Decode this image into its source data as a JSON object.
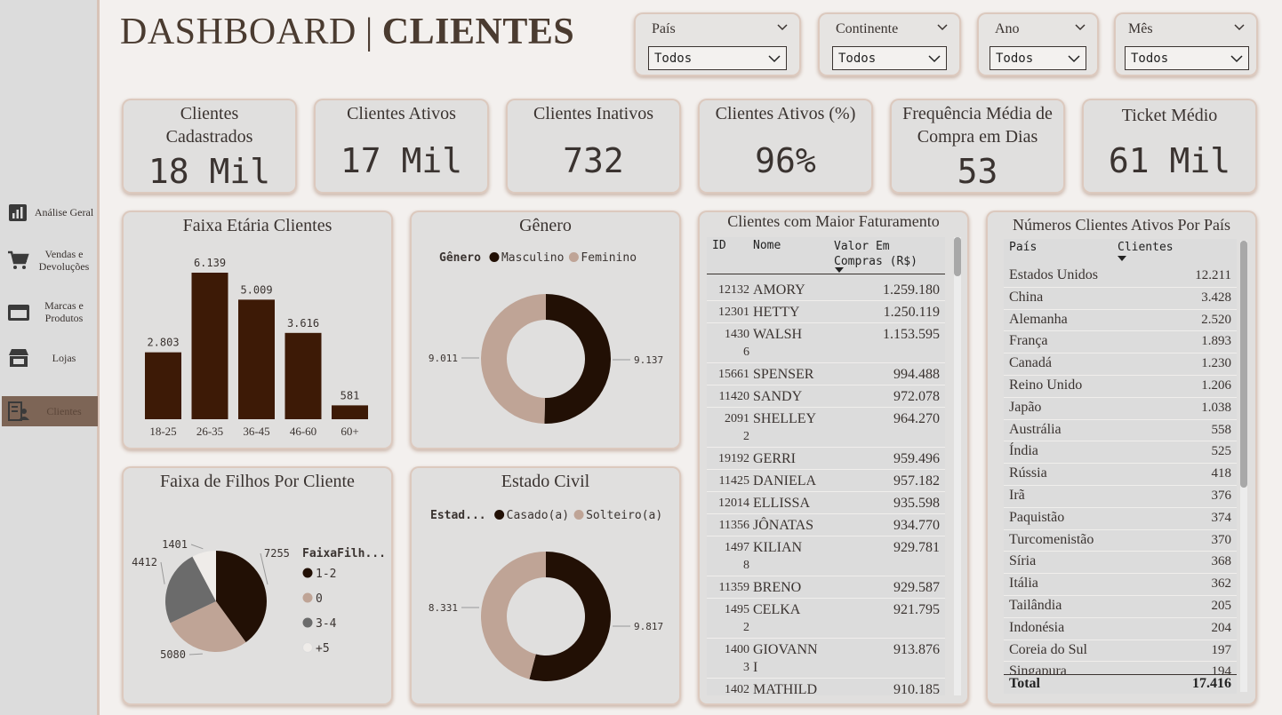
{
  "sidebar": {
    "items": [
      {
        "label": "Análise Geral",
        "icon": "bar-chart-icon"
      },
      {
        "label": "Vendas e Devoluções",
        "icon": "cart-icon"
      },
      {
        "label": "Marcas e Produtos",
        "icon": "wallet-icon"
      },
      {
        "label": "Lojas",
        "icon": "store-icon"
      },
      {
        "label": "Clientes",
        "icon": "customers-icon",
        "active": true
      }
    ]
  },
  "header": {
    "title_a": "DASHBOARD",
    "title_sep": "|",
    "title_b": "CLIENTES"
  },
  "filters": [
    {
      "label": "País",
      "value": "Todos"
    },
    {
      "label": "Continente",
      "value": "Todos"
    },
    {
      "label": "Ano",
      "value": "Todos"
    },
    {
      "label": "Mês",
      "value": "Todos"
    }
  ],
  "kpis": [
    {
      "title": "Clientes Cadastrados",
      "value": "18 Mil"
    },
    {
      "title": "Clientes Ativos",
      "value": "17 Mil"
    },
    {
      "title": "Clientes Inativos",
      "value": "732"
    },
    {
      "title": "Clientes Ativos (%)",
      "value": "96%"
    },
    {
      "title": "Frequência Média de Compra em Dias",
      "value": "53"
    },
    {
      "title": "Ticket Médio",
      "value": "61 Mil"
    }
  ],
  "colors": {
    "dark_brown": "#3d1a06",
    "very_dark": "#221005",
    "tan": "#bfa496",
    "gray": "#6b6b6b",
    "light": "#efece9"
  },
  "chart_data": [
    {
      "type": "bar",
      "title": "Faixa Etária Clientes",
      "categories": [
        "18-25",
        "26-35",
        "36-45",
        "46-60",
        "60+"
      ],
      "values": [
        2803,
        6139,
        5009,
        3616,
        581
      ],
      "value_labels": [
        "2.803",
        "6.139",
        "5.009",
        "3.616",
        "581"
      ]
    },
    {
      "type": "pie",
      "subtype": "donut",
      "title": "Gênero",
      "legend_title": "Gênero",
      "labels": [
        "Masculino",
        "Feminino"
      ],
      "values": [
        9137,
        9011
      ],
      "value_labels": [
        "9.137",
        "9.011"
      ]
    },
    {
      "type": "pie",
      "title": "Faixa de Filhos Por Cliente",
      "legend_title": "FaixaFilh...",
      "labels": [
        "1-2",
        "0",
        "3-4",
        "+5"
      ],
      "values": [
        7255,
        5080,
        4412,
        1401
      ],
      "value_labels": [
        "7255",
        "5080",
        "4412",
        "1401"
      ]
    },
    {
      "type": "pie",
      "subtype": "donut",
      "title": "Estado Civil",
      "legend_title": "Estad...",
      "labels": [
        "Casado(a)",
        "Solteiro(a)"
      ],
      "values": [
        9817,
        8331
      ],
      "value_labels": [
        "9.817",
        "8.331"
      ]
    },
    {
      "type": "table",
      "title": "Clientes com Maior Faturamento",
      "columns": [
        "ID",
        "Nome",
        "Valor Em Compras (R$)"
      ],
      "rows": [
        [
          "12132",
          "AMORY",
          "1.259.180"
        ],
        [
          "12301",
          "HETTY",
          "1.250.119"
        ],
        [
          "14306",
          "WALSH",
          "1.153.595"
        ],
        [
          "15661",
          "SPENSER",
          "994.488"
        ],
        [
          "11420",
          "SANDY",
          "972.078"
        ],
        [
          "20912",
          "SHELLEY",
          "964.270"
        ],
        [
          "19192",
          "GERRI",
          "959.496"
        ],
        [
          "11425",
          "DANIELA",
          "957.182"
        ],
        [
          "12014",
          "ELLISSA",
          "935.598"
        ],
        [
          "11356",
          "JÔNATAS",
          "934.770"
        ],
        [
          "14978",
          "KILIAN",
          "929.781"
        ],
        [
          "11359",
          "BRENO",
          "929.587"
        ],
        [
          "14952",
          "CELKA",
          "921.795"
        ],
        [
          "14003",
          "GIOVANNI",
          "913.876"
        ],
        [
          "1402",
          "MATHILD",
          "910.185"
        ]
      ]
    },
    {
      "type": "table",
      "title": "Números Clientes Ativos Por País",
      "columns": [
        "País",
        "Clientes"
      ],
      "rows": [
        [
          "Estados Unidos",
          "12.211"
        ],
        [
          "China",
          "3.428"
        ],
        [
          "Alemanha",
          "2.520"
        ],
        [
          "França",
          "1.893"
        ],
        [
          "Canadá",
          "1.230"
        ],
        [
          "Reino Unido",
          "1.206"
        ],
        [
          "Japão",
          "1.038"
        ],
        [
          "Austrália",
          "558"
        ],
        [
          "Índia",
          "525"
        ],
        [
          "Rússia",
          "418"
        ],
        [
          "Irã",
          "376"
        ],
        [
          "Paquistão",
          "374"
        ],
        [
          "Turcomenistão",
          "370"
        ],
        [
          "Síria",
          "368"
        ],
        [
          "Itália",
          "362"
        ],
        [
          "Tailândia",
          "205"
        ],
        [
          "Indonésia",
          "204"
        ],
        [
          "Coreia do Sul",
          "197"
        ],
        [
          "Singapura",
          "194"
        ]
      ],
      "total_label": "Total",
      "total_value": "17.416"
    }
  ]
}
